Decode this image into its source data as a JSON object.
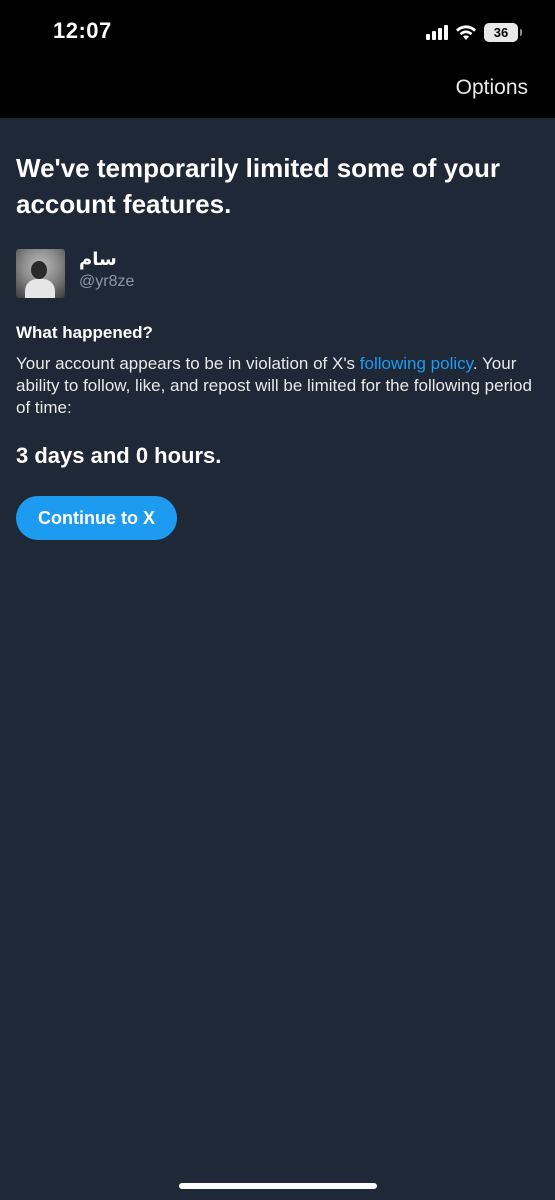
{
  "status_bar": {
    "time": "12:07",
    "battery": "36",
    "icons": [
      "cellular-signal-icon",
      "wifi-icon",
      "battery-icon"
    ]
  },
  "nav": {
    "options_label": "Options"
  },
  "notice": {
    "title": "We've temporarily limited some of your account features.",
    "user": {
      "display_name": "سام",
      "handle": "@yr8ze"
    },
    "section_title": "What happened?",
    "body_before_link": "Your account appears to be in violation of X's ",
    "link_text": "following policy",
    "body_after_link": ". Your ability to follow, like, and repost will be limited for the following period of time:",
    "duration": "3 days and 0 hours.",
    "continue_label": "Continue to X"
  },
  "colors": {
    "background": "#1e2836",
    "bar": "#000000",
    "accent": "#1d9bf0",
    "muted_text": "#8b98a5"
  }
}
